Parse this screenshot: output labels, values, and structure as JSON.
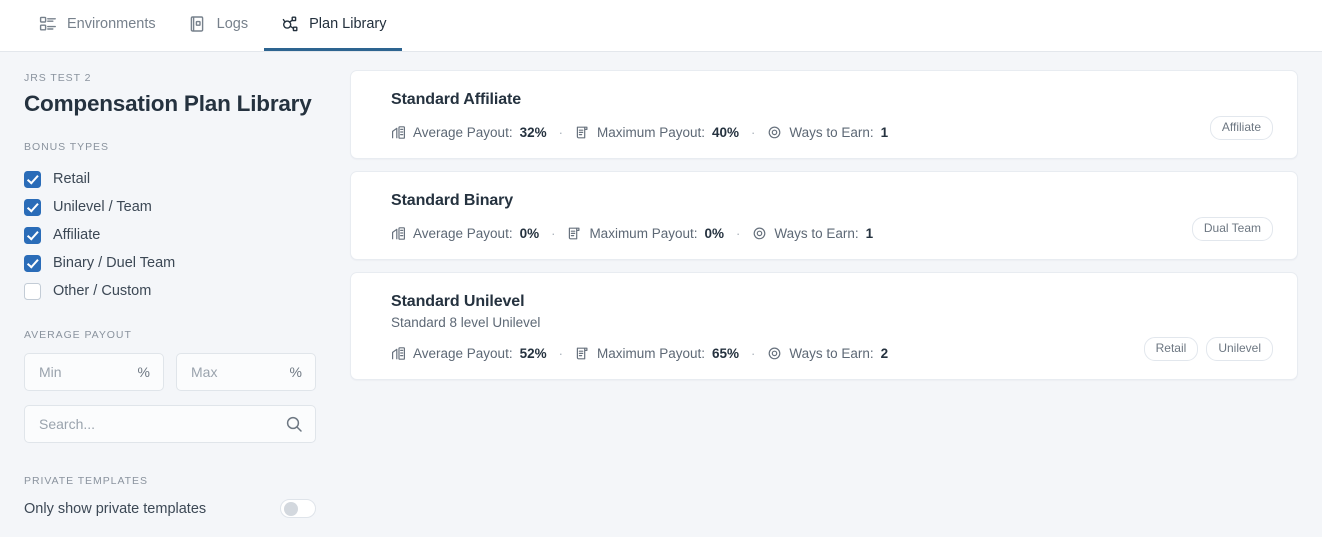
{
  "nav": {
    "tabs": [
      {
        "label": "Environments",
        "icon": "list-grid-icon",
        "active": false
      },
      {
        "label": "Logs",
        "icon": "book-icon",
        "active": false
      },
      {
        "label": "Plan Library",
        "icon": "network-nodes-icon",
        "active": true
      }
    ]
  },
  "sidebar": {
    "eyebrow": "JRS TEST 2",
    "title": "Compensation Plan Library",
    "bonus_types_label": "BONUS TYPES",
    "bonus_types": [
      {
        "label": "Retail",
        "checked": true
      },
      {
        "label": "Unilevel / Team",
        "checked": true
      },
      {
        "label": "Affiliate",
        "checked": true
      },
      {
        "label": "Binary / Duel Team",
        "checked": true
      },
      {
        "label": "Other / Custom",
        "checked": false
      }
    ],
    "average_payout_label": "AVERAGE PAYOUT",
    "min_placeholder": "Min",
    "min_value": "",
    "min_suffix": "%",
    "max_placeholder": "Max",
    "max_value": "",
    "max_suffix": "%",
    "search_placeholder": "Search...",
    "search_value": "",
    "private_templates_label": "PRIVATE TEMPLATES",
    "private_toggle_label": "Only show private templates",
    "private_toggle_on": false
  },
  "labels": {
    "average_payout": "Average Payout:",
    "maximum_payout": "Maximum Payout:",
    "ways_to_earn": "Ways to Earn:",
    "separator": "·"
  },
  "cards": [
    {
      "title": "Standard Affiliate",
      "subtitle": "",
      "average_payout": "32%",
      "maximum_payout": "40%",
      "ways_to_earn": "1",
      "tags": [
        "Affiliate"
      ]
    },
    {
      "title": "Standard Binary",
      "subtitle": "",
      "average_payout": "0%",
      "maximum_payout": "0%",
      "ways_to_earn": "1",
      "tags": [
        "Dual Team"
      ]
    },
    {
      "title": "Standard Unilevel",
      "subtitle": "Standard 8 level Unilevel",
      "average_payout": "52%",
      "maximum_payout": "65%",
      "ways_to_earn": "2",
      "tags": [
        "Retail",
        "Unilevel"
      ]
    }
  ],
  "colors": {
    "accent": "#2a6cb8",
    "active_tab_underline": "#2d6490",
    "page_bg": "#f4f6f9",
    "card_bg": "#ffffff",
    "title_text": "#25323f"
  }
}
